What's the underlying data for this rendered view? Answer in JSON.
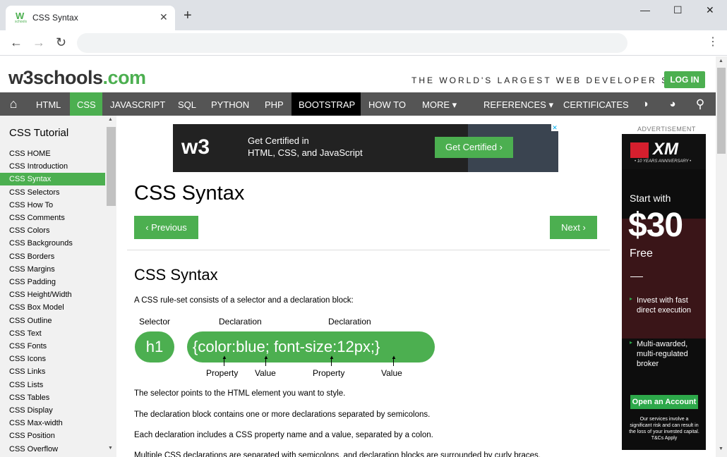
{
  "browser": {
    "tab_title": "CSS Syntax",
    "favicon_text": "W",
    "favicon_sub": "schools",
    "close_tab": "✕",
    "new_tab": "+",
    "minimize": "—",
    "maximize": "☐",
    "close_window": "✕",
    "back": "←",
    "forward": "→",
    "reload": "↻",
    "menu": "⋮",
    "address": ""
  },
  "header": {
    "logo_main": "w3schools",
    "logo_com": ".com",
    "slogan": "THE WORLD'S LARGEST WEB DEVELOPER SITE",
    "login": "LOG IN"
  },
  "nav": {
    "home_icon": "⌂",
    "items": [
      "HTML",
      "CSS",
      "JAVASCRIPT",
      "SQL",
      "PYTHON",
      "PHP",
      "BOOTSTRAP",
      "HOW TO",
      "MORE ▾",
      "REFERENCES ▾",
      "CERTIFICATES"
    ],
    "contrast_icon": "◑",
    "globe_icon": "◕",
    "search_icon": "⚲"
  },
  "sidebar": {
    "title": "CSS Tutorial",
    "items": [
      "CSS HOME",
      "CSS Introduction",
      "CSS Syntax",
      "CSS Selectors",
      "CSS How To",
      "CSS Comments",
      "CSS Colors",
      "CSS Backgrounds",
      "CSS Borders",
      "CSS Margins",
      "CSS Padding",
      "CSS Height/Width",
      "CSS Box Model",
      "CSS Outline",
      "CSS Text",
      "CSS Fonts",
      "CSS Icons",
      "CSS Links",
      "CSS Lists",
      "CSS Tables",
      "CSS Display",
      "CSS Max-width",
      "CSS Position",
      "CSS Overflow"
    ],
    "active_index": 2,
    "scroll_up": "▲",
    "scroll_down": "▼"
  },
  "ad_banner": {
    "logo": "w3",
    "line1": "Get Certified in",
    "line2": "HTML, CSS, and JavaScript",
    "cta": "Get Certified ›",
    "close": "✕"
  },
  "main": {
    "title": "CSS Syntax",
    "prev": "‹ Previous",
    "next": "Next ›",
    "subtitle": "CSS Syntax",
    "intro": "A CSS rule-set consists of a selector and a declaration block:",
    "diagram": {
      "selector_label": "Selector",
      "declaration_label_1": "Declaration",
      "declaration_label_2": "Declaration",
      "selector_text": "h1",
      "block_text": "{color:blue; font-size:12px;}",
      "property_label_1": "Property",
      "value_label_1": "Value",
      "property_label_2": "Property",
      "value_label_2": "Value"
    },
    "p1": "The selector points to the HTML element you want to style.",
    "p2": "The declaration block contains one or more declarations separated by semicolons.",
    "p3": "Each declaration includes a CSS property name and a value, separated by a colon.",
    "p4": "Multiple CSS declarations are separated with semicolons, and declaration blocks are surrounded by curly braces."
  },
  "right_ad": {
    "label": "ADVERTISEMENT",
    "brand": "XM",
    "anniversary": "• 10 YEARS ANNIVERSARY •",
    "start_with": "Start with",
    "amount": "$30",
    "free": "Free",
    "bullet1": "Invest with fast direct execution",
    "bullet2": "Multi-awarded, multi-regulated broker",
    "cta": "Open an Account",
    "disclaimer": "Our services involve a significant risk and can result in the loss of your invested capital. T&Cs Apply"
  },
  "colors": {
    "accent": "#4caf50",
    "nav_bg": "#555555",
    "sidebar_bg": "#f1f1f1"
  }
}
